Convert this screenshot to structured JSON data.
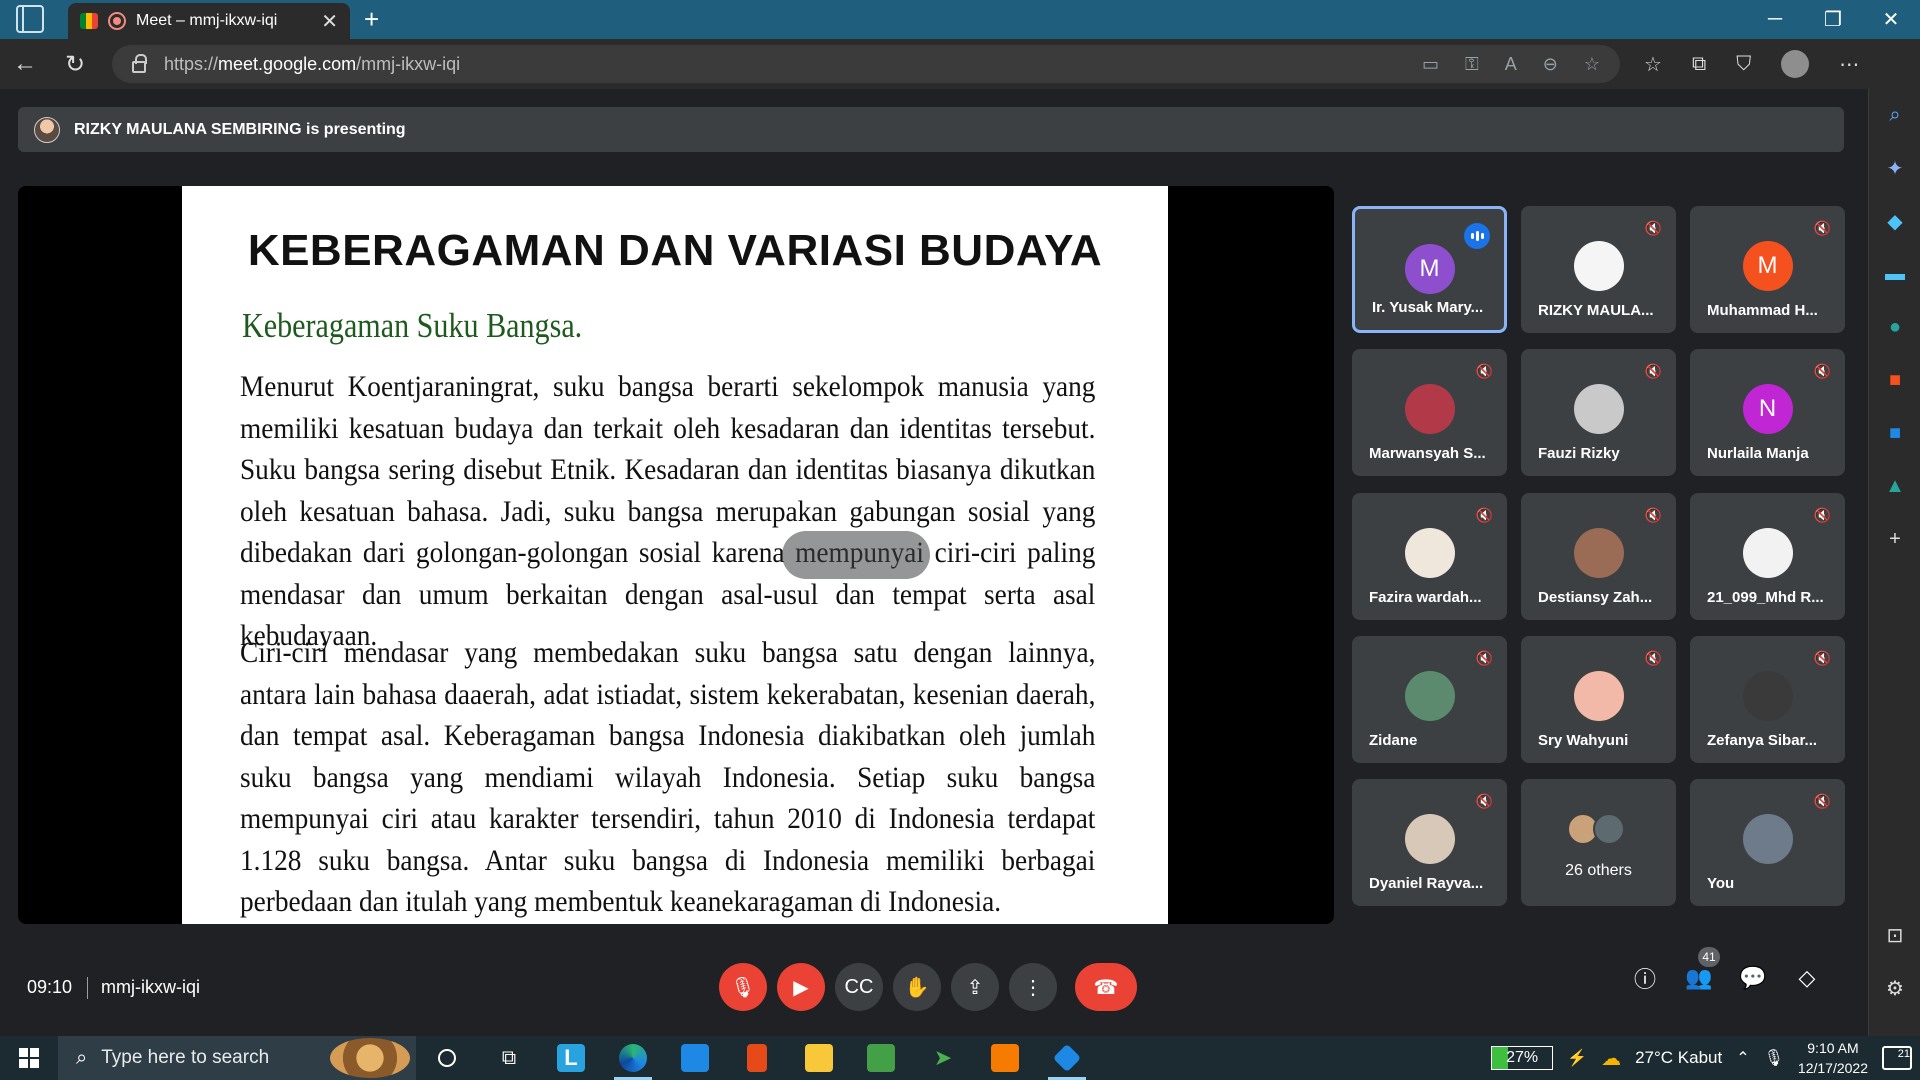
{
  "browser": {
    "tab_title": "Meet – mmj-ikxw-iqi",
    "url_prefix": "https://",
    "url_host": "meet.google.com",
    "url_path": "/mmj-ikxw-iqi"
  },
  "meet": {
    "presenting_text": "RIZKY MAULANA SEMBIRING is presenting",
    "time": "09:10",
    "meeting_code": "mmj-ikxw-iqi",
    "participants_badge": "41"
  },
  "slide": {
    "title": "KEBERAGAMAN DAN VARIASI BUDAYA",
    "subtitle": "Keberagaman Suku Bangsa.",
    "paragraph1": "Menurut Koentjaraningrat, suku bangsa berarti sekelompok manusia yang memiliki kesatuan budaya dan terkait oleh kesadaran dan identitas tersebut. Suku bangsa sering disebut Etnik. Kesadaran dan identitas biasanya dikutkan oleh kesatuan bahasa. Jadi, suku bangsa merupakan gabungan sosial yang dibedakan dari golongan-golongan sosial karena mempunyai ciri-ciri paling mendasar dan umum berkaitan dengan asal-usul dan tempat serta asal kebudayaan.",
    "paragraph2": "Ciri-ciri mendasar yang membedakan suku bangsa satu dengan lainnya, antara lain bahasa daaerah, adat istiadat, sistem kekerabatan, kesenian daerah, dan tempat asal. Keberagaman bangsa Indonesia diakibatkan oleh jumlah suku bangsa yang mendiami wilayah Indonesia. Setiap suku bangsa mempunyai ciri atau karakter tersendiri, tahun 2010 di Indonesia terdapat 1.128 suku bangsa. Antar suku bangsa di Indonesia memiliki berbagai perbedaan dan itulah yang membentuk keanekaragaman di Indonesia."
  },
  "participants": [
    {
      "name": "Ir. Yusak Mary...",
      "initial": "M",
      "color": "#8e4fcf",
      "speaking": true
    },
    {
      "name": "RIZKY MAULA...",
      "initial": "",
      "color": "#f5f5f5"
    },
    {
      "name": "Muhammad H...",
      "initial": "M",
      "color": "#f4511e"
    },
    {
      "name": "Marwansyah S...",
      "initial": "",
      "color": "#b23a48"
    },
    {
      "name": "Fauzi Rizky",
      "initial": "",
      "color": "#c9c9c9"
    },
    {
      "name": "Nurlaila Manja",
      "initial": "N",
      "color": "#c026d3"
    },
    {
      "name": "Fazira wardah...",
      "initial": "",
      "color": "#efe6dc"
    },
    {
      "name": "Destiansy Zah...",
      "initial": "",
      "color": "#9a6b55"
    },
    {
      "name": "21_099_Mhd R...",
      "initial": "",
      "color": "#f2f2f2"
    },
    {
      "name": "Zidane",
      "initial": "",
      "color": "#5b8a6e"
    },
    {
      "name": "Sry Wahyuni",
      "initial": "",
      "color": "#f2b8a8"
    },
    {
      "name": "Zefanya Sibar...",
      "initial": "",
      "color": "#3a3a3a"
    },
    {
      "name": "Dyaniel Rayva...",
      "initial": "",
      "color": "#d8c8b8"
    },
    {
      "name": "You",
      "initial": "",
      "color": "#6d7b8a"
    }
  ],
  "others_label": "26 others",
  "taskbar": {
    "search_placeholder": "Type here to search",
    "battery": "27%",
    "weather": "27°C  Kabut",
    "time": "9:10 AM",
    "date": "12/17/2022",
    "notifications": "21"
  }
}
